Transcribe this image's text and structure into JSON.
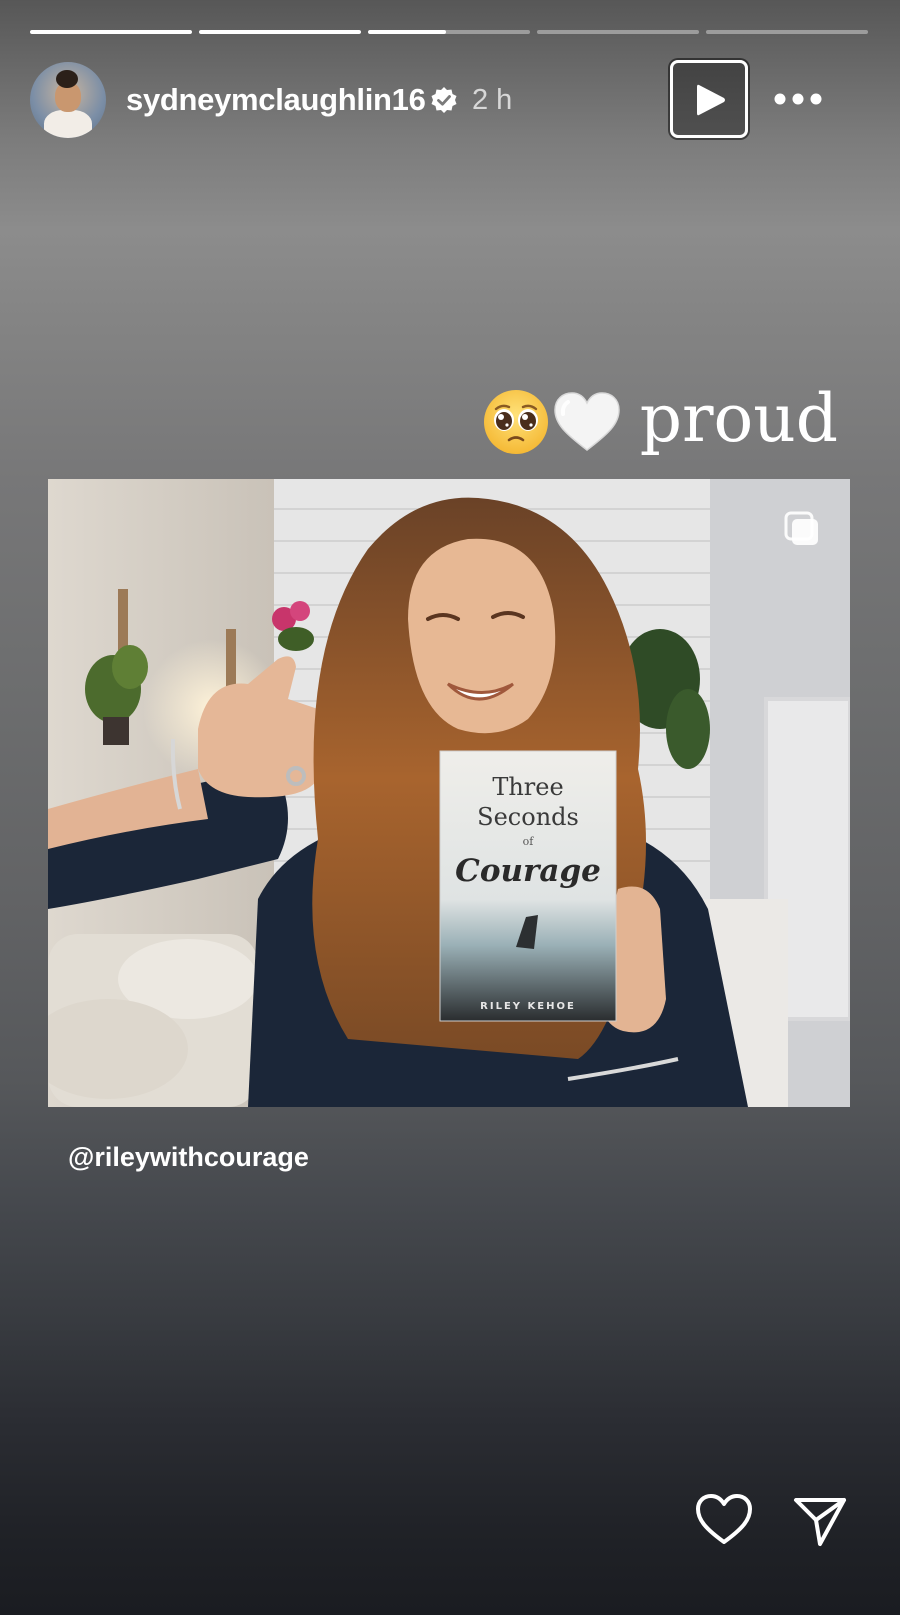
{
  "story": {
    "progress": [
      1,
      1,
      0.48,
      0,
      0
    ]
  },
  "header": {
    "username": "sydneymclaughlin16",
    "verified_icon": "verified-badge-icon",
    "time_ago": "2 h",
    "play_icon": "play-icon",
    "more_icon": "more-horizontal-icon"
  },
  "sticker": {
    "emojis": [
      "pleading-face-emoji",
      "white-heart-emoji"
    ],
    "text": "proud"
  },
  "photo": {
    "book": {
      "title_line1": "Three",
      "title_line2": "Seconds",
      "title_of": "of",
      "title_line3": "Courage",
      "author": "RILEY KEHOE"
    },
    "multi_icon": "carousel-multiple-icon"
  },
  "mention": "@rileywithcourage",
  "footer": {
    "like_icon": "heart-outline-icon",
    "share_icon": "send-paper-plane-icon"
  },
  "colors": {
    "text": "#ffffff",
    "background_bottom": "#1a1c21"
  }
}
